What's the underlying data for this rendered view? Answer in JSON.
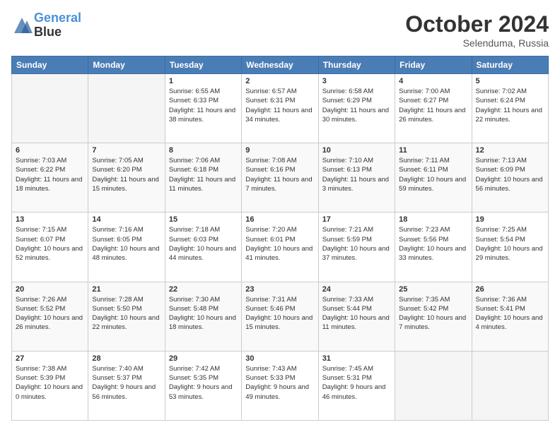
{
  "header": {
    "logo_line1": "General",
    "logo_line2": "Blue",
    "month": "October 2024",
    "location": "Selenduma, Russia"
  },
  "weekdays": [
    "Sunday",
    "Monday",
    "Tuesday",
    "Wednesday",
    "Thursday",
    "Friday",
    "Saturday"
  ],
  "weeks": [
    [
      {
        "day": "",
        "info": ""
      },
      {
        "day": "",
        "info": ""
      },
      {
        "day": "1",
        "info": "Sunrise: 6:55 AM\nSunset: 6:33 PM\nDaylight: 11 hours\nand 38 minutes."
      },
      {
        "day": "2",
        "info": "Sunrise: 6:57 AM\nSunset: 6:31 PM\nDaylight: 11 hours\nand 34 minutes."
      },
      {
        "day": "3",
        "info": "Sunrise: 6:58 AM\nSunset: 6:29 PM\nDaylight: 11 hours\nand 30 minutes."
      },
      {
        "day": "4",
        "info": "Sunrise: 7:00 AM\nSunset: 6:27 PM\nDaylight: 11 hours\nand 26 minutes."
      },
      {
        "day": "5",
        "info": "Sunrise: 7:02 AM\nSunset: 6:24 PM\nDaylight: 11 hours\nand 22 minutes."
      }
    ],
    [
      {
        "day": "6",
        "info": "Sunrise: 7:03 AM\nSunset: 6:22 PM\nDaylight: 11 hours\nand 18 minutes."
      },
      {
        "day": "7",
        "info": "Sunrise: 7:05 AM\nSunset: 6:20 PM\nDaylight: 11 hours\nand 15 minutes."
      },
      {
        "day": "8",
        "info": "Sunrise: 7:06 AM\nSunset: 6:18 PM\nDaylight: 11 hours\nand 11 minutes."
      },
      {
        "day": "9",
        "info": "Sunrise: 7:08 AM\nSunset: 6:16 PM\nDaylight: 11 hours\nand 7 minutes."
      },
      {
        "day": "10",
        "info": "Sunrise: 7:10 AM\nSunset: 6:13 PM\nDaylight: 11 hours\nand 3 minutes."
      },
      {
        "day": "11",
        "info": "Sunrise: 7:11 AM\nSunset: 6:11 PM\nDaylight: 10 hours\nand 59 minutes."
      },
      {
        "day": "12",
        "info": "Sunrise: 7:13 AM\nSunset: 6:09 PM\nDaylight: 10 hours\nand 56 minutes."
      }
    ],
    [
      {
        "day": "13",
        "info": "Sunrise: 7:15 AM\nSunset: 6:07 PM\nDaylight: 10 hours\nand 52 minutes."
      },
      {
        "day": "14",
        "info": "Sunrise: 7:16 AM\nSunset: 6:05 PM\nDaylight: 10 hours\nand 48 minutes."
      },
      {
        "day": "15",
        "info": "Sunrise: 7:18 AM\nSunset: 6:03 PM\nDaylight: 10 hours\nand 44 minutes."
      },
      {
        "day": "16",
        "info": "Sunrise: 7:20 AM\nSunset: 6:01 PM\nDaylight: 10 hours\nand 41 minutes."
      },
      {
        "day": "17",
        "info": "Sunrise: 7:21 AM\nSunset: 5:59 PM\nDaylight: 10 hours\nand 37 minutes."
      },
      {
        "day": "18",
        "info": "Sunrise: 7:23 AM\nSunset: 5:56 PM\nDaylight: 10 hours\nand 33 minutes."
      },
      {
        "day": "19",
        "info": "Sunrise: 7:25 AM\nSunset: 5:54 PM\nDaylight: 10 hours\nand 29 minutes."
      }
    ],
    [
      {
        "day": "20",
        "info": "Sunrise: 7:26 AM\nSunset: 5:52 PM\nDaylight: 10 hours\nand 26 minutes."
      },
      {
        "day": "21",
        "info": "Sunrise: 7:28 AM\nSunset: 5:50 PM\nDaylight: 10 hours\nand 22 minutes."
      },
      {
        "day": "22",
        "info": "Sunrise: 7:30 AM\nSunset: 5:48 PM\nDaylight: 10 hours\nand 18 minutes."
      },
      {
        "day": "23",
        "info": "Sunrise: 7:31 AM\nSunset: 5:46 PM\nDaylight: 10 hours\nand 15 minutes."
      },
      {
        "day": "24",
        "info": "Sunrise: 7:33 AM\nSunset: 5:44 PM\nDaylight: 10 hours\nand 11 minutes."
      },
      {
        "day": "25",
        "info": "Sunrise: 7:35 AM\nSunset: 5:42 PM\nDaylight: 10 hours\nand 7 minutes."
      },
      {
        "day": "26",
        "info": "Sunrise: 7:36 AM\nSunset: 5:41 PM\nDaylight: 10 hours\nand 4 minutes."
      }
    ],
    [
      {
        "day": "27",
        "info": "Sunrise: 7:38 AM\nSunset: 5:39 PM\nDaylight: 10 hours\nand 0 minutes."
      },
      {
        "day": "28",
        "info": "Sunrise: 7:40 AM\nSunset: 5:37 PM\nDaylight: 9 hours\nand 56 minutes."
      },
      {
        "day": "29",
        "info": "Sunrise: 7:42 AM\nSunset: 5:35 PM\nDaylight: 9 hours\nand 53 minutes."
      },
      {
        "day": "30",
        "info": "Sunrise: 7:43 AM\nSunset: 5:33 PM\nDaylight: 9 hours\nand 49 minutes."
      },
      {
        "day": "31",
        "info": "Sunrise: 7:45 AM\nSunset: 5:31 PM\nDaylight: 9 hours\nand 46 minutes."
      },
      {
        "day": "",
        "info": ""
      },
      {
        "day": "",
        "info": ""
      }
    ]
  ]
}
